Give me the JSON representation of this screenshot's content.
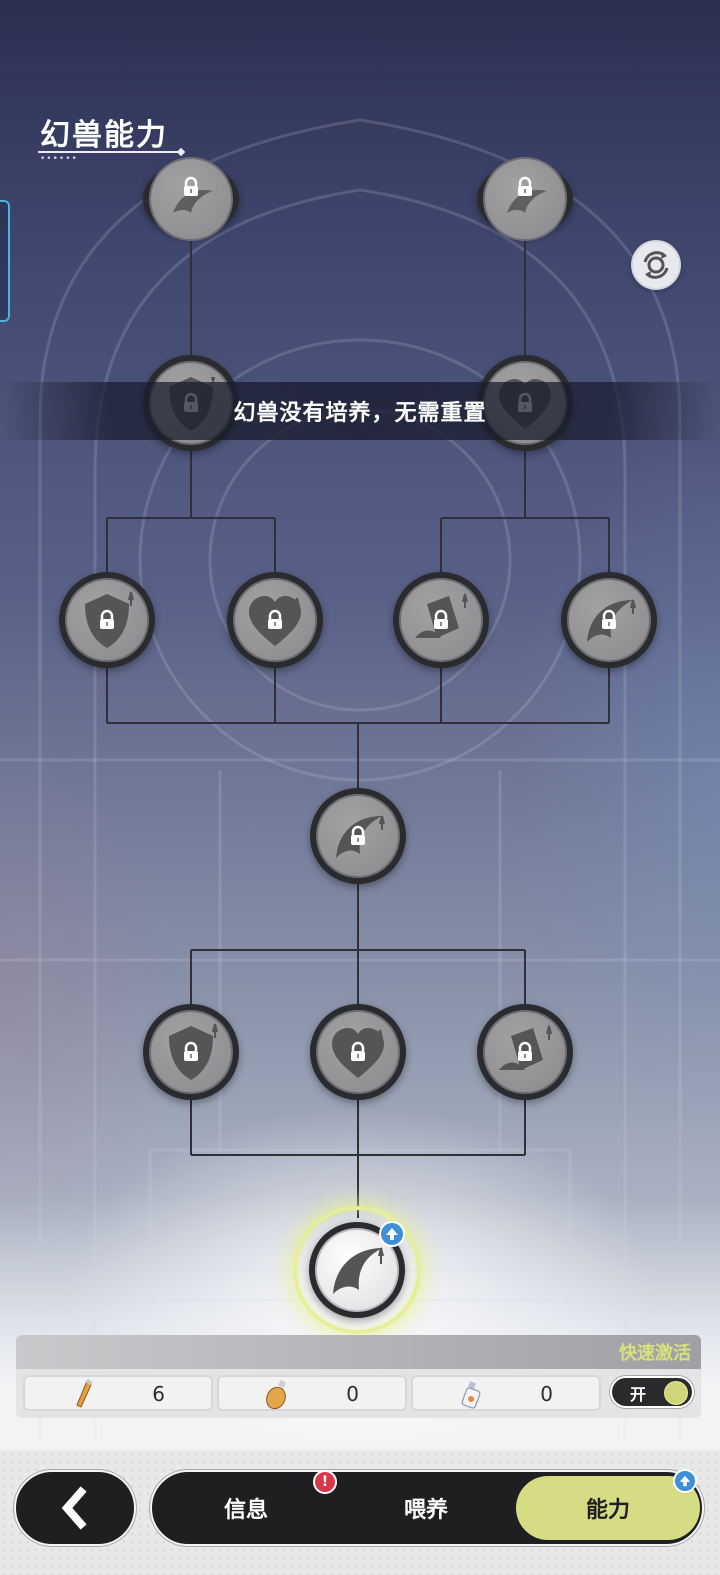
{
  "page": {
    "title": "幻兽能力",
    "title_dots": "••••••"
  },
  "toast": {
    "message": "幻兽没有培养，无需重置"
  },
  "tree": {
    "nodes": [
      {
        "row": 0,
        "icon": "claw-icon",
        "locked": true
      },
      {
        "row": 0,
        "icon": "claw-icon",
        "locked": true
      },
      {
        "row": 1,
        "icon": "shield-icon",
        "locked": true
      },
      {
        "row": 1,
        "icon": "heart-icon",
        "locked": true
      },
      {
        "row": 2,
        "icon": "shield-icon",
        "locked": true
      },
      {
        "row": 2,
        "icon": "heart-icon",
        "locked": true
      },
      {
        "row": 2,
        "icon": "card-icon",
        "locked": true
      },
      {
        "row": 2,
        "icon": "claw-icon",
        "locked": true
      },
      {
        "row": 3,
        "icon": "claw-icon",
        "locked": true
      },
      {
        "row": 4,
        "icon": "shield-icon",
        "locked": true
      },
      {
        "row": 4,
        "icon": "heart-icon",
        "locked": true
      },
      {
        "row": 4,
        "icon": "card-icon",
        "locked": true
      },
      {
        "row": 5,
        "icon": "claw-icon",
        "locked": false,
        "active": true
      }
    ]
  },
  "panel": {
    "quick_activate_label": "快速激活",
    "resources": [
      {
        "icon": "small-potion-icon",
        "value": "6"
      },
      {
        "icon": "round-potion-icon",
        "value": "0"
      },
      {
        "icon": "bottle-potion-icon",
        "value": "0"
      }
    ],
    "toggle": {
      "label": "开",
      "on": true
    }
  },
  "nav": {
    "tabs": [
      {
        "label": "信息",
        "alert": "!"
      },
      {
        "label": "喂养"
      },
      {
        "label": "能力",
        "selected": true
      }
    ]
  },
  "colors": {
    "accent": "#d6dc84",
    "active_glow": "#e7ee9a",
    "badge_blue": "#3d8fd8",
    "alert_red": "#d8384a",
    "quick_activate_text": "#d9e27a"
  }
}
